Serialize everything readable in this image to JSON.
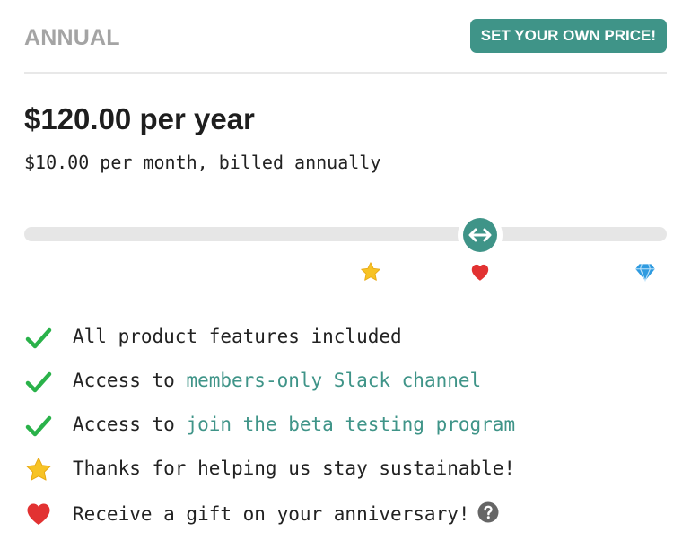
{
  "plan": {
    "name": "ANNUAL",
    "own_price_label": "SET YOUR OWN PRICE!",
    "price": "$120.00 per year",
    "price_sub": "$10.00 per month, billed annually"
  },
  "slider": {
    "value_fraction": 0.71,
    "tiers": [
      {
        "icon": "star-icon",
        "color": "#f7c325"
      },
      {
        "icon": "heart-icon",
        "color": "#e23232"
      },
      {
        "icon": "diamond-icon",
        "color": "#2f9be0"
      }
    ]
  },
  "colors": {
    "accent": "#3f9488",
    "check": "#2ab24a",
    "star": "#f7c325",
    "heart": "#e23232",
    "diamond": "#2f9be0",
    "help": "#666666"
  },
  "features": [
    {
      "icon": "check-icon",
      "text": "All product features included",
      "link": ""
    },
    {
      "icon": "check-icon",
      "text": "Access to ",
      "link": "members-only Slack channel"
    },
    {
      "icon": "check-icon",
      "text": "Access to ",
      "link": "join the beta testing program"
    },
    {
      "icon": "star-icon",
      "text": "Thanks for helping us stay sustainable!",
      "link": ""
    },
    {
      "icon": "heart-icon",
      "text": "Receive a gift on your anniversary!",
      "link": "",
      "help": "question-icon"
    }
  ]
}
